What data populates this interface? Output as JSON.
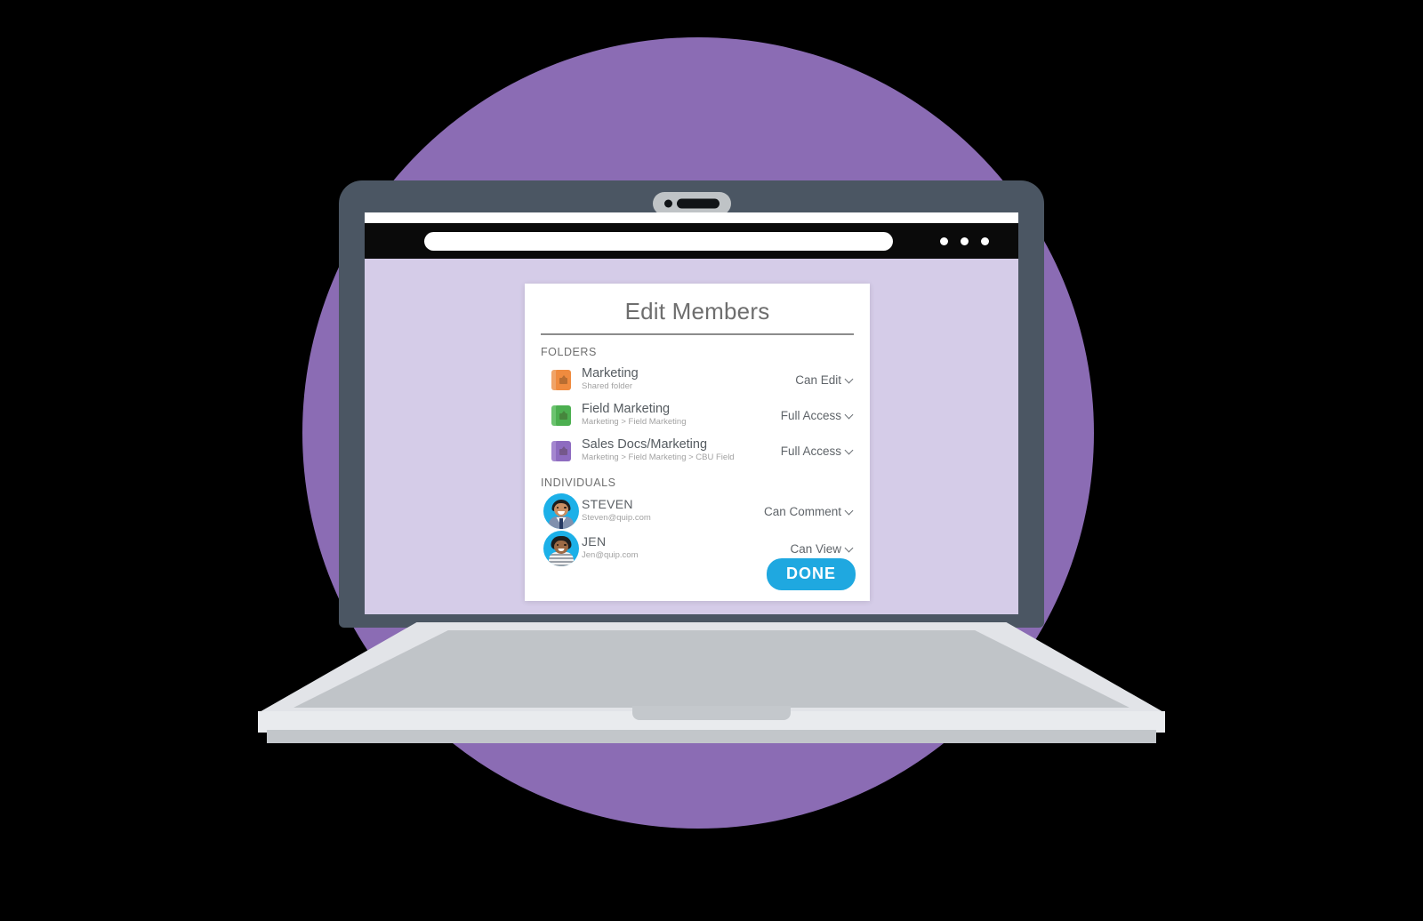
{
  "scene": {
    "background_color": "#000000",
    "backdrop_circle_color": "#8b6cb4",
    "laptop_bezel_color": "#4b5663",
    "screen_background_color": "#d5cce8",
    "browser_toolbar_color": "#0a0a0a"
  },
  "browser": {
    "url_value": "",
    "url_placeholder": "",
    "menu_dots": [
      "dot",
      "dot",
      "dot"
    ]
  },
  "dialog": {
    "title": "Edit Members",
    "sections": [
      {
        "header": "FOLDERS",
        "rows": [
          {
            "icon": "folder-icon",
            "icon_color": "#ef8b3f",
            "name": "Marketing",
            "subtitle": "Shared folder",
            "permission": "Can Edit"
          },
          {
            "icon": "folder-icon",
            "icon_color": "#4caf50",
            "name": "Field Marketing",
            "subtitle": "Marketing > Field Marketing",
            "permission": "Full Access"
          },
          {
            "icon": "folder-icon",
            "icon_color": "#8e6cc0",
            "name": "Sales Docs/Marketing",
            "subtitle": "Marketing > Field Marketing > CBU Field",
            "permission": "Full Access"
          }
        ]
      },
      {
        "header": "INDIVIDUALS",
        "rows": [
          {
            "icon": "avatar-icon",
            "icon_color": "#1cb0e8",
            "name": "STEVEN",
            "subtitle": "Steven@quip.com",
            "permission": "Can Comment"
          },
          {
            "icon": "avatar-icon",
            "icon_color": "#1cb0e8",
            "name": "JEN",
            "subtitle": "Jen@quip.com",
            "permission": "Can View"
          }
        ]
      }
    ],
    "done_label": "DONE",
    "done_color": "#1fa8e0",
    "chevron_icon": "chevron-down-icon"
  }
}
